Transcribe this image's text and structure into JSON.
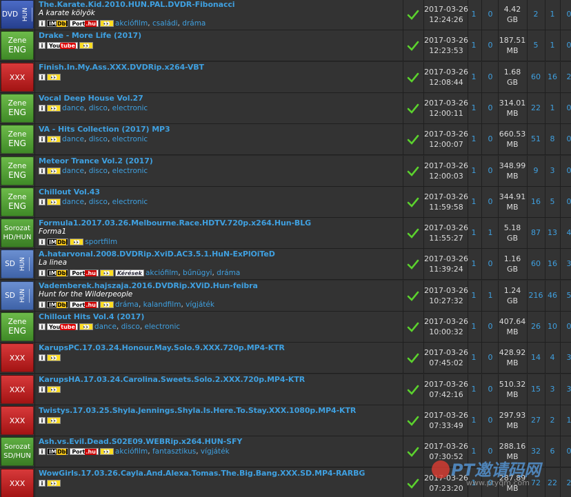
{
  "rows": [
    {
      "cat": "dvd",
      "c1": "DVD",
      "c2": "HUN",
      "title": "The.Karate.Kid.2010.HUN.PAL.DVDR-Fibonacci",
      "subtitle": "A karate kölyök",
      "badges": [
        "info",
        "imdb",
        "port",
        "eye"
      ],
      "genres": [
        "akciófilm",
        "családi",
        "dráma"
      ],
      "date": "2017-03-26",
      "time": "12:24:26",
      "n1": "1",
      "n2": "0",
      "size": "4.42",
      "unit": "GB",
      "n3": "2",
      "n4": "1",
      "n5": "0"
    },
    {
      "cat": "zene",
      "c1": "Zene",
      "c2": "ENG",
      "title": "Drake - More Life (2017)",
      "subtitle": "",
      "badges": [
        "info",
        "yt",
        "eye"
      ],
      "genres": [],
      "date": "2017-03-26",
      "time": "12:23:53",
      "n1": "1",
      "n2": "0",
      "size": "187.51",
      "unit": "MB",
      "n3": "5",
      "n4": "1",
      "n5": "0"
    },
    {
      "cat": "xxx",
      "c1": "XXX",
      "c2": "",
      "title": "Finish.In.My.Ass.XXX.DVDRip.x264-VBT",
      "subtitle": "",
      "badges": [
        "info",
        "eye"
      ],
      "genres": [],
      "date": "2017-03-26",
      "time": "12:08:44",
      "n1": "1",
      "n2": "0",
      "size": "1.68",
      "unit": "GB",
      "n3": "60",
      "n4": "16",
      "n5": "2"
    },
    {
      "cat": "zene",
      "c1": "Zene",
      "c2": "ENG",
      "title": "Vocal Deep House Vol.27",
      "subtitle": "",
      "badges": [
        "info",
        "eye"
      ],
      "genres": [
        "dance",
        "disco",
        "electronic"
      ],
      "date": "2017-03-26",
      "time": "12:00:11",
      "n1": "1",
      "n2": "0",
      "size": "314.01",
      "unit": "MB",
      "n3": "22",
      "n4": "1",
      "n5": "0"
    },
    {
      "cat": "zene",
      "c1": "Zene",
      "c2": "ENG",
      "title": "VA - Hits Collection (2017) MP3",
      "subtitle": "",
      "badges": [
        "info",
        "eye"
      ],
      "genres": [
        "dance",
        "disco",
        "electronic"
      ],
      "date": "2017-03-26",
      "time": "12:00:07",
      "n1": "1",
      "n2": "0",
      "size": "660.53",
      "unit": "MB",
      "n3": "51",
      "n4": "8",
      "n5": "0"
    },
    {
      "cat": "zene",
      "c1": "Zene",
      "c2": "ENG",
      "title": "Meteor Trance Vol.2 (2017)",
      "subtitle": "",
      "badges": [
        "info",
        "eye"
      ],
      "genres": [
        "dance",
        "disco",
        "electronic"
      ],
      "date": "2017-03-26",
      "time": "12:00:03",
      "n1": "1",
      "n2": "0",
      "size": "348.99",
      "unit": "MB",
      "n3": "9",
      "n4": "3",
      "n5": "0"
    },
    {
      "cat": "zene",
      "c1": "Zene",
      "c2": "ENG",
      "title": "Chillout Vol.43",
      "subtitle": "",
      "badges": [
        "info",
        "eye"
      ],
      "genres": [
        "dance",
        "disco",
        "electronic"
      ],
      "date": "2017-03-26",
      "time": "11:59:58",
      "n1": "1",
      "n2": "0",
      "size": "344.91",
      "unit": "MB",
      "n3": "16",
      "n4": "5",
      "n5": "0"
    },
    {
      "cat": "sorozat",
      "c1": "Sorozat",
      "c2": "HD/HUN",
      "title": "Formula1.2017.03.26.Melbourne.Race.HDTV.720p.x264.Hun-BLG",
      "subtitle": "Forma1",
      "badges": [
        "info",
        "imdb",
        "eye"
      ],
      "genres": [
        "sportfilm"
      ],
      "date": "2017-03-26",
      "time": "11:55:27",
      "n1": "1",
      "n2": "1",
      "size": "5.18",
      "unit": "GB",
      "n3": "87",
      "n4": "13",
      "n5": "4"
    },
    {
      "cat": "sd",
      "c1": "SD",
      "c2": "HUN",
      "title": "A.hatarvonal.2008.DVDRip.XviD.AC3.5.1.HuN-ExPlOiTeD",
      "subtitle": "La linea",
      "badges": [
        "info",
        "imdb",
        "port",
        "eye",
        "ker"
      ],
      "genres": [
        "akciófilm",
        "bűnügyi",
        "dráma"
      ],
      "date": "2017-03-26",
      "time": "11:39:24",
      "n1": "1",
      "n2": "0",
      "size": "1.16",
      "unit": "GB",
      "n3": "60",
      "n4": "16",
      "n5": "3"
    },
    {
      "cat": "sd",
      "c1": "SD",
      "c2": "HUN",
      "title": "Vademberek.hajszaja.2016.DVDRip.XViD.Hun-feibra",
      "subtitle": "Hunt for the Wilderpeople",
      "badges": [
        "info",
        "imdb",
        "port",
        "eye"
      ],
      "genres": [
        "dráma",
        "kalandfilm",
        "vígjáték"
      ],
      "date": "2017-03-26",
      "time": "10:27:32",
      "n1": "1",
      "n2": "1",
      "size": "1.24",
      "unit": "GB",
      "n3": "216",
      "n4": "46",
      "n5": "5"
    },
    {
      "cat": "zene",
      "c1": "Zene",
      "c2": "ENG",
      "title": "Chillout Hits Vol.4 (2017)",
      "subtitle": "",
      "badges": [
        "info",
        "yt",
        "eye"
      ],
      "genres": [
        "dance",
        "disco",
        "electronic"
      ],
      "date": "2017-03-26",
      "time": "10:00:32",
      "n1": "1",
      "n2": "0",
      "size": "407.64",
      "unit": "MB",
      "n3": "26",
      "n4": "10",
      "n5": "0"
    },
    {
      "cat": "xxx",
      "c1": "XXX",
      "c2": "",
      "title": "KarupsPC.17.03.24.Honour.May.Solo.9.XXX.720p.MP4-KTR",
      "subtitle": "",
      "badges": [
        "info",
        "eye"
      ],
      "genres": [],
      "date": "2017-03-26",
      "time": "07:45:02",
      "n1": "1",
      "n2": "0",
      "size": "428.92",
      "unit": "MB",
      "n3": "14",
      "n4": "4",
      "n5": "3"
    },
    {
      "cat": "xxx",
      "c1": "XXX",
      "c2": "",
      "title": "KarupsHA.17.03.24.Carolina.Sweets.Solo.2.XXX.720p.MP4-KTR",
      "subtitle": "",
      "badges": [
        "info",
        "eye"
      ],
      "genres": [],
      "date": "2017-03-26",
      "time": "07:42:16",
      "n1": "1",
      "n2": "0",
      "size": "510.32",
      "unit": "MB",
      "n3": "15",
      "n4": "3",
      "n5": "3"
    },
    {
      "cat": "xxx",
      "c1": "XXX",
      "c2": "",
      "title": "Twistys.17.03.25.Shyla.Jennings.Shyla.Is.Here.To.Stay.XXX.1080p.MP4-KTR",
      "subtitle": "",
      "badges": [
        "info",
        "eye"
      ],
      "genres": [],
      "date": "2017-03-26",
      "time": "07:33:49",
      "n1": "1",
      "n2": "0",
      "size": "297.93",
      "unit": "MB",
      "n3": "27",
      "n4": "2",
      "n5": "1"
    },
    {
      "cat": "sorozat",
      "c1": "Sorozat",
      "c2": "SD/HUN",
      "title": "Ash.vs.Evil.Dead.S02E09.WEBRip.x264.HUN-SFY",
      "subtitle": "",
      "badges": [
        "info",
        "imdb",
        "port",
        "eye"
      ],
      "genres": [
        "akciófilm",
        "fantasztikus",
        "vígjáték"
      ],
      "date": "2017-03-26",
      "time": "07:30:52",
      "n1": "1",
      "n2": "0",
      "size": "288.16",
      "unit": "MB",
      "n3": "32",
      "n4": "6",
      "n5": "0"
    },
    {
      "cat": "xxx",
      "c1": "XXX",
      "c2": "",
      "title": "WowGirls.17.03.26.Cayla.And.Alexa.Tomas.The.Big.Bang.XXX.SD.MP4-RARBG",
      "subtitle": "",
      "badges": [
        "info",
        "eye"
      ],
      "genres": [],
      "date": "2017-03-26",
      "time": "07:23:20",
      "n1": "1",
      "n2": "0",
      "size": "287.89",
      "unit": "MB",
      "n3": "72",
      "n4": "22",
      "n5": "2"
    }
  ],
  "badge_text": {
    "info": "i",
    "imdb_a": "IM",
    "imdb_b": "Db",
    "port_a": "Port",
    "port_b": ".hu",
    "yt_a": "You",
    "yt_b": "tube",
    "eye": "👀",
    "ker": "Kérések"
  },
  "watermark": {
    "text": "PT邀请码网",
    "url": "www.ptyqm.com"
  },
  "colors": {
    "link": "#3fa0e0",
    "check": "#5bd22d",
    "row_bg": "#333333"
  }
}
